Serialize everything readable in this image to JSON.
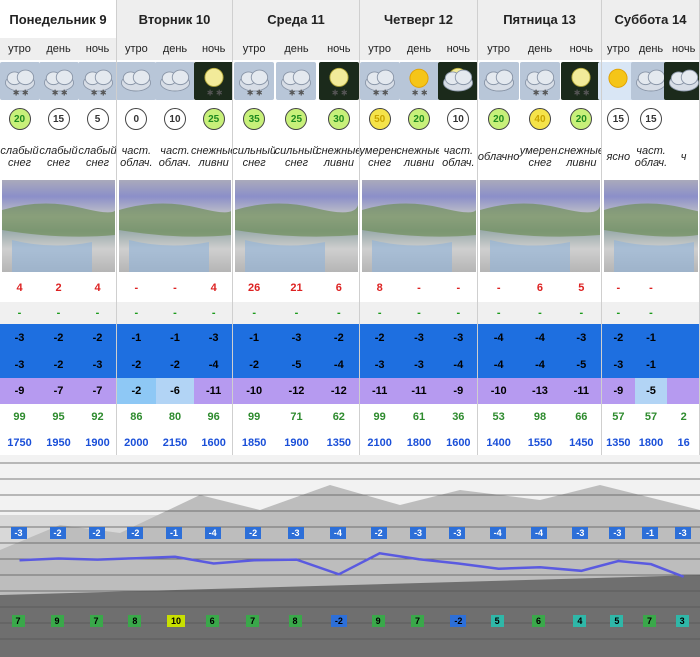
{
  "days": [
    {
      "name": "Понедельник 9"
    },
    {
      "name": "Вторник 10"
    },
    {
      "name": "Среда 11"
    },
    {
      "name": "Четверг 12"
    },
    {
      "name": "Пятница 13"
    },
    {
      "name": "Суббота 14"
    }
  ],
  "periods": [
    "утро",
    "день",
    "ночь"
  ],
  "columns": [
    {
      "icon": "cloud-snow-icon",
      "wind": "20",
      "desc": "слабый снег"
    },
    {
      "icon": "cloud-snow-icon",
      "wind": "15",
      "desc": "слабый снег"
    },
    {
      "icon": "cloud-snow-icon",
      "wind": "5",
      "desc": "слабый снег"
    },
    {
      "icon": "partly-cloudy-day-icon",
      "wind": "0",
      "desc": "част. облач."
    },
    {
      "icon": "partly-cloudy-day-icon",
      "wind": "10",
      "desc": "част. облач."
    },
    {
      "icon": "moon-snow-icon",
      "wind": "25",
      "desc": "снежные ливни"
    },
    {
      "icon": "cloud-heavy-snow-icon",
      "wind": "35",
      "desc": "сильный снег"
    },
    {
      "icon": "cloud-heavy-snow-icon",
      "wind": "25",
      "desc": "сильный снег"
    },
    {
      "icon": "moon-snow-icon",
      "wind": "30",
      "desc": "снежные ливни"
    },
    {
      "icon": "cloud-snow-icon",
      "wind": "50",
      "desc": "умерен. снег"
    },
    {
      "icon": "sun-snow-icon",
      "wind": "20",
      "desc": "снежные ливни"
    },
    {
      "icon": "moon-cloud-icon",
      "wind": "10",
      "desc": "част. облач."
    },
    {
      "icon": "cloudy-icon",
      "wind": "20",
      "desc": "облачно"
    },
    {
      "icon": "cloud-snow-icon",
      "wind": "40",
      "desc": "умерен. снег"
    },
    {
      "icon": "moon-snow-icon",
      "wind": "20",
      "desc": "снежные ливни"
    },
    {
      "icon": "sun-icon",
      "wind": "15",
      "desc": "ясно"
    },
    {
      "icon": "partly-cloudy-day-icon",
      "wind": "15",
      "desc": "част. облач."
    },
    {
      "icon": "partly-cloudy-night-icon",
      "wind": "",
      "desc": "ч"
    }
  ],
  "rows": {
    "snowfall": [
      "4",
      "2",
      "4",
      "-",
      "-",
      "4",
      "26",
      "21",
      "6",
      "8",
      "-",
      "-",
      "-",
      "6",
      "5",
      "-",
      "-",
      ""
    ],
    "rain": [
      "-",
      "-",
      "-",
      "-",
      "-",
      "-",
      "-",
      "-",
      "-",
      "-",
      "-",
      "-",
      "-",
      "-",
      "-",
      "-",
      "-",
      ""
    ],
    "temp_a": [
      "-3",
      "-2",
      "-2",
      "-1",
      "-1",
      "-3",
      "-1",
      "-3",
      "-2",
      "-2",
      "-3",
      "-3",
      "-4",
      "-4",
      "-3",
      "-2",
      "-1",
      ""
    ],
    "temp_b": [
      "-3",
      "-2",
      "-3",
      "-2",
      "-2",
      "-4",
      "-2",
      "-5",
      "-4",
      "-3",
      "-3",
      "-4",
      "-4",
      "-4",
      "-5",
      "-3",
      "-1",
      ""
    ],
    "temp_c": [
      "-9",
      "-7",
      "-7",
      "-2",
      "-6",
      "-11",
      "-10",
      "-12",
      "-12",
      "-11",
      "-11",
      "-9",
      "-10",
      "-13",
      "-11",
      "-9",
      "-5",
      ""
    ],
    "humidity": [
      "99",
      "95",
      "92",
      "86",
      "80",
      "96",
      "99",
      "71",
      "62",
      "99",
      "61",
      "36",
      "53",
      "98",
      "66",
      "57",
      "57",
      "2"
    ],
    "freezing": [
      "1750",
      "1950",
      "1900",
      "2000",
      "2150",
      "1600",
      "1850",
      "1900",
      "1350",
      "2100",
      "1800",
      "1600",
      "1400",
      "1550",
      "1450",
      "1350",
      "1800",
      "16"
    ]
  },
  "colors": {
    "temp_blue": "#1e6fe0",
    "temp_light_blue": "#8ec8f5",
    "temp_purple": "#b69af0",
    "humidity_green": "#2e8b2e",
    "freezing_blue": "#1a4fd8",
    "snow_red": "#dd2222"
  },
  "chart": {
    "top_badges": [
      "-3",
      "-2",
      "-2",
      "-2",
      "-1",
      "-4",
      "-2",
      "-3",
      "-4",
      "-2",
      "-3",
      "-3",
      "-4",
      "-4",
      "-3",
      "-3",
      "-1",
      "-3"
    ],
    "bottom_badges": [
      "7",
      "9",
      "7",
      "8",
      "10",
      "6",
      "7",
      "8",
      "-2",
      "9",
      "7",
      "-2",
      "5",
      "6",
      "4",
      "5",
      "7",
      "3"
    ],
    "line": [
      0.38,
      0.33,
      0.36,
      0.32,
      0.28,
      0.47,
      0.38,
      0.36,
      0.78,
      0.18,
      0.35,
      0.47,
      0.62,
      0.58,
      0.68,
      0.4,
      0.49,
      0.85
    ]
  }
}
